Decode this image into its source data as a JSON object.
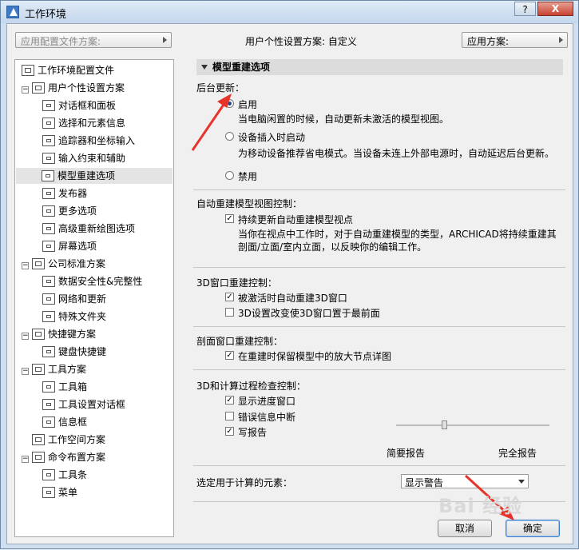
{
  "window": {
    "title": "工作环境",
    "help_label": "?",
    "close_label": "X"
  },
  "header": {
    "profile_combo_placeholder": "应用配置文件方案:",
    "user_scheme_text": "用户个性设置方案:  自定义",
    "apply_scheme_label": "应用方案:"
  },
  "tree": {
    "items": [
      {
        "label": "工作环境配置文件"
      },
      {
        "label": "用户个性设置方案"
      },
      {
        "label": "对话框和面板"
      },
      {
        "label": "选择和元素信息"
      },
      {
        "label": "追踪器和坐标输入"
      },
      {
        "label": "输入约束和辅助"
      },
      {
        "label": "模型重建选项"
      },
      {
        "label": "发布器"
      },
      {
        "label": "更多选项"
      },
      {
        "label": "高级重新绘图选项"
      },
      {
        "label": "屏幕选项"
      },
      {
        "label": "公司标准方案"
      },
      {
        "label": "数据安全性&完整性"
      },
      {
        "label": "网络和更新"
      },
      {
        "label": "特殊文件夹"
      },
      {
        "label": "快捷键方案"
      },
      {
        "label": "键盘快捷键"
      },
      {
        "label": "工具方案"
      },
      {
        "label": "工具箱"
      },
      {
        "label": "工具设置对话框"
      },
      {
        "label": "信息框"
      },
      {
        "label": "工作空间方案"
      },
      {
        "label": "命令布置方案"
      },
      {
        "label": "工具条"
      },
      {
        "label": "菜单"
      }
    ],
    "expander_minus": "−"
  },
  "panel": {
    "section_title": "模型重建选项",
    "background_update": {
      "label": "后台更新：",
      "options": [
        {
          "label": "启用",
          "desc": "当电脑闲置的时候，自动更新未激活的模型视图。"
        },
        {
          "label": "设备插入时启动",
          "desc": "为移动设备推荐省电模式。当设备未连上外部电源时，自动延迟后台更新。"
        },
        {
          "label": "禁用"
        }
      ],
      "selected": "启用"
    },
    "auto_rebuild": {
      "label": "自动重建模型视图控制：",
      "option": "持续更新自动重建模型视点",
      "desc": "当你在视点中工作时，对于自动重建模型的类型，ARCHICAD将持续重建其剖面/立面/室内立面，以反映你的编辑工作。"
    },
    "window3d": {
      "label": "3D窗口重建控制：",
      "options": [
        "被激活时自动重建3D窗口",
        "3D设置改变使3D窗口置于最前面"
      ]
    },
    "section_window": {
      "label": "剖面窗口重建控制：",
      "option": "在重建时保留模型中的放大节点详图"
    },
    "calc_check": {
      "label": "3D和计算过程检查控制：",
      "options": [
        "显示进度窗口",
        "错误信息中断",
        "写报告"
      ],
      "slider_min_label": "简要报告",
      "slider_max_label": "完全报告",
      "slider_level": 0.3
    },
    "calc_elements": {
      "label": "选定用于计算的元素：",
      "value": "显示警告"
    },
    "buttons": {
      "cancel": "取消",
      "ok": "确定"
    },
    "check_mark": "✓"
  },
  "watermark": "Bai 经验",
  "colors": {
    "annotation_arrow": "#e8332a",
    "title_bar": "#cfdff0"
  }
}
